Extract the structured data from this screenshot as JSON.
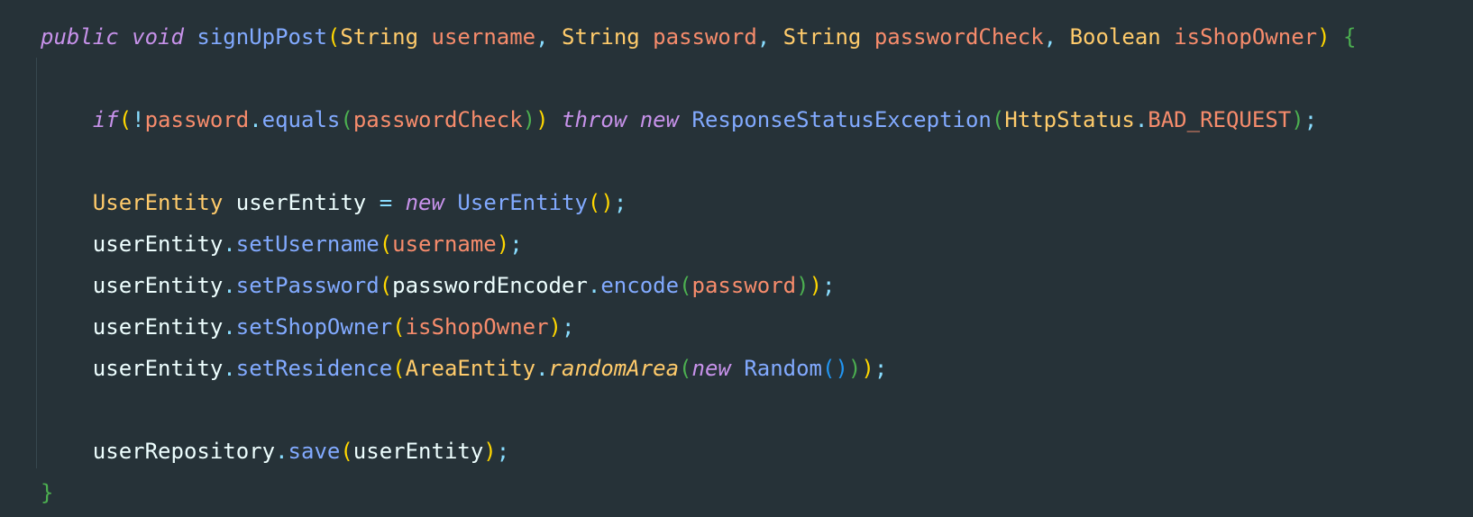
{
  "editor": {
    "language": "Java",
    "theme_colors": {
      "background": "#263238",
      "keyword": "#c792ea",
      "function": "#82aaff",
      "type": "#ffcb6b",
      "parameter": "#f78c6c",
      "punctuation": "#89ddff",
      "text": "#eeffff",
      "bracket_level_1": "#ffd700",
      "bracket_level_2": "#4caf50",
      "bracket_level_3": "#2196f3"
    },
    "lines": [
      {
        "tokens": [
          {
            "t": "public",
            "c": "kw"
          },
          {
            "t": " "
          },
          {
            "t": "void",
            "c": "kw"
          },
          {
            "t": " "
          },
          {
            "t": "signUpPost",
            "c": "fn"
          },
          {
            "t": "(",
            "c": "pb1"
          },
          {
            "t": "String",
            "c": "ty"
          },
          {
            "t": " "
          },
          {
            "t": "username",
            "c": "param"
          },
          {
            "t": ", ",
            "c": "punct"
          },
          {
            "t": "String",
            "c": "ty"
          },
          {
            "t": " "
          },
          {
            "t": "password",
            "c": "param"
          },
          {
            "t": ", ",
            "c": "punct"
          },
          {
            "t": "String",
            "c": "ty"
          },
          {
            "t": " "
          },
          {
            "t": "passwordCheck",
            "c": "param"
          },
          {
            "t": ", ",
            "c": "punct"
          },
          {
            "t": "Boolean",
            "c": "ty"
          },
          {
            "t": " "
          },
          {
            "t": "isShopOwner",
            "c": "param"
          },
          {
            "t": ")",
            "c": "pb1"
          },
          {
            "t": " "
          },
          {
            "t": "{",
            "c": "brace"
          }
        ]
      },
      {
        "tokens": []
      },
      {
        "tokens": [
          {
            "t": "    "
          },
          {
            "t": "if",
            "c": "kw"
          },
          {
            "t": "(",
            "c": "pb1"
          },
          {
            "t": "!",
            "c": "punct"
          },
          {
            "t": "password",
            "c": "param"
          },
          {
            "t": ".",
            "c": "punct"
          },
          {
            "t": "equals",
            "c": "fn"
          },
          {
            "t": "(",
            "c": "pb2"
          },
          {
            "t": "passwordCheck",
            "c": "param"
          },
          {
            "t": ")",
            "c": "pb2"
          },
          {
            "t": ")",
            "c": "pb1"
          },
          {
            "t": " "
          },
          {
            "t": "throw",
            "c": "kw"
          },
          {
            "t": " "
          },
          {
            "t": "new",
            "c": "kw"
          },
          {
            "t": " "
          },
          {
            "t": "ResponseStatusException",
            "c": "fn"
          },
          {
            "t": "(",
            "c": "pb2"
          },
          {
            "t": "HttpStatus",
            "c": "ty"
          },
          {
            "t": ".",
            "c": "punct"
          },
          {
            "t": "BAD_REQUEST",
            "c": "param"
          },
          {
            "t": ")",
            "c": "pb2"
          },
          {
            "t": ";",
            "c": "punct"
          }
        ]
      },
      {
        "tokens": []
      },
      {
        "tokens": [
          {
            "t": "    "
          },
          {
            "t": "UserEntity",
            "c": "ty"
          },
          {
            "t": " "
          },
          {
            "t": "userEntity",
            "c": "var"
          },
          {
            "t": " "
          },
          {
            "t": "=",
            "c": "punct"
          },
          {
            "t": " "
          },
          {
            "t": "new",
            "c": "kw"
          },
          {
            "t": " "
          },
          {
            "t": "UserEntity",
            "c": "fn"
          },
          {
            "t": "()",
            "c": "pb1"
          },
          {
            "t": ";",
            "c": "punct"
          }
        ]
      },
      {
        "tokens": [
          {
            "t": "    "
          },
          {
            "t": "userEntity",
            "c": "var"
          },
          {
            "t": ".",
            "c": "punct"
          },
          {
            "t": "setUsername",
            "c": "fn"
          },
          {
            "t": "(",
            "c": "pb1"
          },
          {
            "t": "username",
            "c": "param"
          },
          {
            "t": ")",
            "c": "pb1"
          },
          {
            "t": ";",
            "c": "punct"
          }
        ]
      },
      {
        "tokens": [
          {
            "t": "    "
          },
          {
            "t": "userEntity",
            "c": "var"
          },
          {
            "t": ".",
            "c": "punct"
          },
          {
            "t": "setPassword",
            "c": "fn"
          },
          {
            "t": "(",
            "c": "pb1"
          },
          {
            "t": "passwordEncoder",
            "c": "var"
          },
          {
            "t": ".",
            "c": "punct"
          },
          {
            "t": "encode",
            "c": "fn"
          },
          {
            "t": "(",
            "c": "pb2"
          },
          {
            "t": "password",
            "c": "param"
          },
          {
            "t": ")",
            "c": "pb2"
          },
          {
            "t": ")",
            "c": "pb1"
          },
          {
            "t": ";",
            "c": "punct"
          }
        ]
      },
      {
        "tokens": [
          {
            "t": "    "
          },
          {
            "t": "userEntity",
            "c": "var"
          },
          {
            "t": ".",
            "c": "punct"
          },
          {
            "t": "setShopOwner",
            "c": "fn"
          },
          {
            "t": "(",
            "c": "pb1"
          },
          {
            "t": "isShopOwner",
            "c": "param"
          },
          {
            "t": ")",
            "c": "pb1"
          },
          {
            "t": ";",
            "c": "punct"
          }
        ]
      },
      {
        "tokens": [
          {
            "t": "    "
          },
          {
            "t": "userEntity",
            "c": "var"
          },
          {
            "t": ".",
            "c": "punct"
          },
          {
            "t": "setResidence",
            "c": "fn"
          },
          {
            "t": "(",
            "c": "pb1"
          },
          {
            "t": "AreaEntity",
            "c": "ty"
          },
          {
            "t": ".",
            "c": "punct"
          },
          {
            "t": "randomArea",
            "c": "ty italic"
          },
          {
            "t": "(",
            "c": "pb2"
          },
          {
            "t": "new",
            "c": "kw"
          },
          {
            "t": " "
          },
          {
            "t": "Random",
            "c": "fn"
          },
          {
            "t": "()",
            "c": "pb3"
          },
          {
            "t": ")",
            "c": "pb2"
          },
          {
            "t": ")",
            "c": "pb1"
          },
          {
            "t": ";",
            "c": "punct"
          }
        ]
      },
      {
        "tokens": []
      },
      {
        "tokens": [
          {
            "t": "    "
          },
          {
            "t": "userRepository",
            "c": "var"
          },
          {
            "t": ".",
            "c": "punct"
          },
          {
            "t": "save",
            "c": "fn"
          },
          {
            "t": "(",
            "c": "pb1"
          },
          {
            "t": "userEntity",
            "c": "var"
          },
          {
            "t": ")",
            "c": "pb1"
          },
          {
            "t": ";",
            "c": "punct"
          }
        ]
      },
      {
        "tokens": [
          {
            "t": "}",
            "c": "brace"
          }
        ]
      }
    ]
  }
}
